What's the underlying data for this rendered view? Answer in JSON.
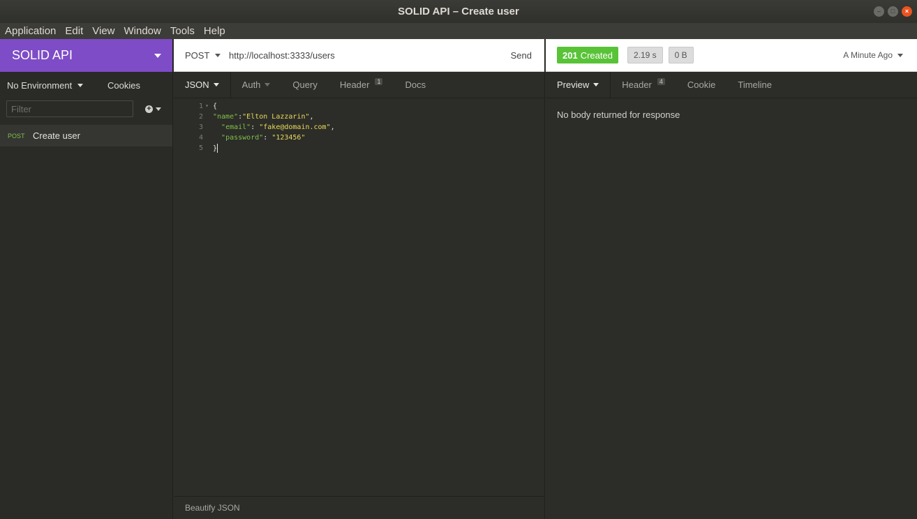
{
  "window": {
    "title": "SOLID API – Create user"
  },
  "menubar": {
    "items": [
      "Application",
      "Edit",
      "View",
      "Window",
      "Tools",
      "Help"
    ]
  },
  "sidebar": {
    "workspace": "SOLID API",
    "environment": "No Environment",
    "cookies_label": "Cookies",
    "filter_placeholder": "Filter",
    "requests": [
      {
        "method": "POST",
        "name": "Create user"
      }
    ]
  },
  "request": {
    "method": "POST",
    "url": "http://localhost:3333/users",
    "send_label": "Send",
    "tabs": {
      "body": "JSON",
      "auth": "Auth",
      "query": "Query",
      "header": "Header",
      "header_count": "1",
      "docs": "Docs"
    },
    "body_lines": [
      {
        "num": "1",
        "parts": [
          {
            "t": "p",
            "v": "{"
          }
        ]
      },
      {
        "num": "2",
        "parts": [
          {
            "t": "k",
            "v": "\"name\""
          },
          {
            "t": "p",
            "v": ":"
          },
          {
            "t": "s",
            "v": "\"Elton Lazzarin\""
          },
          {
            "t": "p",
            "v": ","
          }
        ]
      },
      {
        "num": "3",
        "parts": [
          {
            "t": "p",
            "v": "  "
          },
          {
            "t": "k",
            "v": "\"email\""
          },
          {
            "t": "p",
            "v": ": "
          },
          {
            "t": "s",
            "v": "\"fake@domain.com\""
          },
          {
            "t": "p",
            "v": ","
          }
        ]
      },
      {
        "num": "4",
        "parts": [
          {
            "t": "p",
            "v": "  "
          },
          {
            "t": "k",
            "v": "\"password\""
          },
          {
            "t": "p",
            "v": ": "
          },
          {
            "t": "s",
            "v": "\"123456\""
          }
        ]
      },
      {
        "num": "5",
        "parts": [
          {
            "t": "p",
            "v": "}"
          }
        ]
      }
    ],
    "footer_label": "Beautify JSON"
  },
  "response": {
    "status_code": "201",
    "status_text": "Created",
    "time": "2.19 s",
    "size": "0 B",
    "age": "A Minute Ago",
    "tabs": {
      "preview": "Preview",
      "header": "Header",
      "header_count": "4",
      "cookie": "Cookie",
      "timeline": "Timeline"
    },
    "body_message": "No body returned for response"
  },
  "colors": {
    "workspace_accent": "#7e4cc6",
    "status_success": "#59c337",
    "json_key": "#7ec24a",
    "json_string": "#e8dc5a"
  }
}
